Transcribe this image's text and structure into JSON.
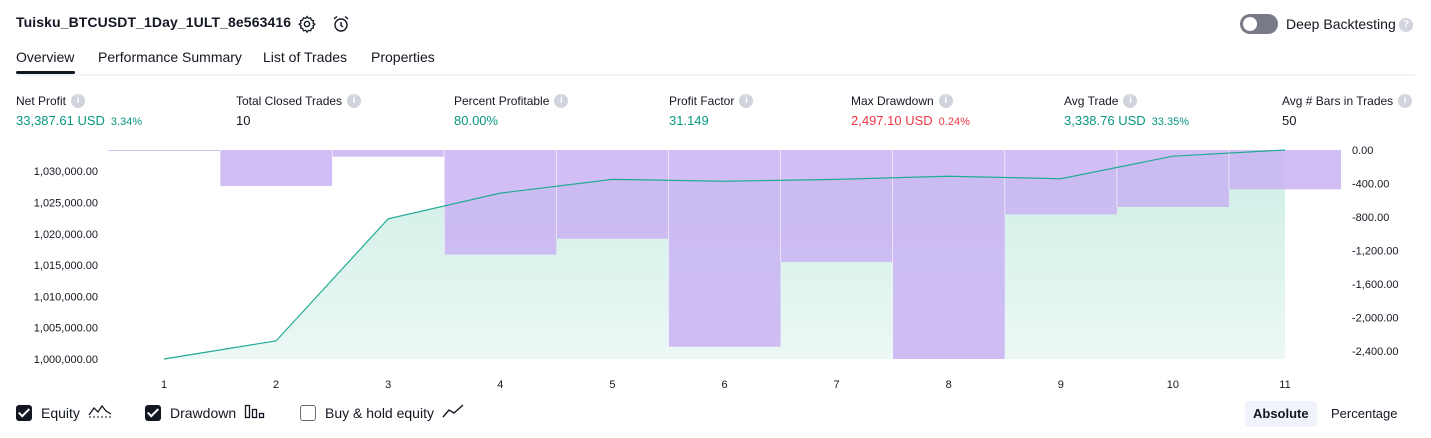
{
  "header": {
    "title": "Tuisku_BTCUSDT_1Day_1ULT_8e563416",
    "deep_backtesting_label": "Deep Backtesting",
    "deep_backtesting_on": false
  },
  "tabs": [
    {
      "label": "Overview",
      "active": true
    },
    {
      "label": "Performance Summary",
      "active": false
    },
    {
      "label": "List of Trades",
      "active": false
    },
    {
      "label": "Properties",
      "active": false
    }
  ],
  "metrics": [
    {
      "label": "Net Profit",
      "value": "33,387.61 USD",
      "pct": "3.34%",
      "color": "#089981"
    },
    {
      "label": "Total Closed Trades",
      "value": "10",
      "pct": "",
      "color": "#131722"
    },
    {
      "label": "Percent Profitable",
      "value": "80.00%",
      "pct": "",
      "color": "#089981"
    },
    {
      "label": "Profit Factor",
      "value": "31.149",
      "pct": "",
      "color": "#089981"
    },
    {
      "label": "Max Drawdown",
      "value": "2,497.10 USD",
      "pct": "0.24%",
      "color": "#f23645"
    },
    {
      "label": "Avg Trade",
      "value": "3,338.76 USD",
      "pct": "33.35%",
      "color": "#089981"
    },
    {
      "label": "Avg # Bars in Trades",
      "value": "50",
      "pct": "",
      "color": "#131722"
    }
  ],
  "chart_data": {
    "type": "line",
    "x": [
      1,
      2,
      3,
      4,
      5,
      6,
      7,
      8,
      9,
      10,
      11
    ],
    "series": [
      {
        "name": "Equity",
        "axis": "left",
        "values": [
          1000000,
          1002900,
          1022400,
          1026500,
          1028700,
          1028400,
          1028700,
          1029200,
          1028800,
          1032400,
          1033387.61
        ]
      },
      {
        "name": "Drawdown",
        "axis": "right",
        "type": "bar",
        "values": [
          -5,
          -430,
          -80,
          -1250,
          -1060,
          -2350,
          -1340,
          -2497.1,
          -770,
          -680,
          -470
        ]
      }
    ],
    "y_left_ticks": [
      "1,030,000.00",
      "1,025,000.00",
      "1,020,000.00",
      "1,015,000.00",
      "1,010,000.00",
      "1,005,000.00",
      "1,000,000.00"
    ],
    "y_left_values": [
      1030000,
      1025000,
      1020000,
      1015000,
      1010000,
      1005000,
      1000000
    ],
    "y_right_ticks": [
      "0.00",
      "-400.00",
      "-800.00",
      "-1,200.00",
      "-1,600.00",
      "-2,000.00",
      "-2,400.00"
    ],
    "y_right_values": [
      0,
      -400,
      -800,
      -1200,
      -1600,
      -2000,
      -2400
    ],
    "x_ticks": [
      "1",
      "2",
      "3",
      "4",
      "5",
      "6",
      "7",
      "8",
      "9",
      "10",
      "11"
    ],
    "colors": {
      "equity_line": "#22ab94",
      "equity_fill": "#cdeee6",
      "drawdown": "#c9b3f2",
      "drawdown_top": "#e2c5fb"
    }
  },
  "legend": [
    {
      "label": "Equity",
      "checked": true,
      "icon": "equity-wave-icon"
    },
    {
      "label": "Drawdown",
      "checked": true,
      "icon": "drawdown-bars-icon"
    },
    {
      "label": "Buy & hold equity",
      "checked": false,
      "icon": "buy-hold-line-icon"
    }
  ],
  "mode_buttons": [
    {
      "label": "Absolute",
      "active": true
    },
    {
      "label": "Percentage",
      "active": false
    }
  ]
}
